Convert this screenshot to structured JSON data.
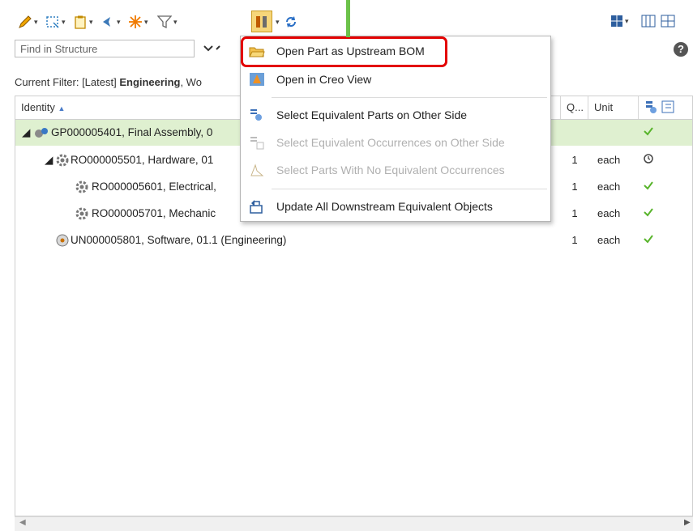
{
  "search": {
    "placeholder": "Find in Structure"
  },
  "filter": {
    "prefix": "Current Filter: [Latest] ",
    "bold": "Engineering",
    "suffix": ", Wo"
  },
  "columns": {
    "identity": "Identity",
    "qty": "Q...",
    "unit": "Unit"
  },
  "rows": [
    {
      "name": "GP000005401, Final Assembly, 0",
      "qty": "",
      "unit": "",
      "status": "check"
    },
    {
      "name": "RO000005501, Hardware, 01",
      "qty": "1",
      "unit": "each",
      "status": "clock"
    },
    {
      "name": "RO000005601, Electrical,",
      "qty": "1",
      "unit": "each",
      "status": "check"
    },
    {
      "name": "RO000005701, Mechanic",
      "qty": "1",
      "unit": "each",
      "status": "check"
    },
    {
      "name": "UN000005801, Software, 01.1 (Engineering)",
      "qty": "1",
      "unit": "each",
      "status": "check"
    }
  ],
  "menu": {
    "open_upstream": "Open Part as Upstream BOM",
    "open_creo": "Open in Creo View",
    "select_equiv_parts": "Select Equivalent Parts on Other Side",
    "select_equiv_occ": "Select Equivalent Occurrences on Other Side",
    "select_no_equiv": "Select Parts With No Equivalent Occurrences",
    "update_downstream": "Update All Downstream Equivalent Objects"
  },
  "colors": {
    "selected_row": "#dff0d0",
    "highlight": "#e30000",
    "pointer": "#6cc24a",
    "check": "#58b42b"
  }
}
